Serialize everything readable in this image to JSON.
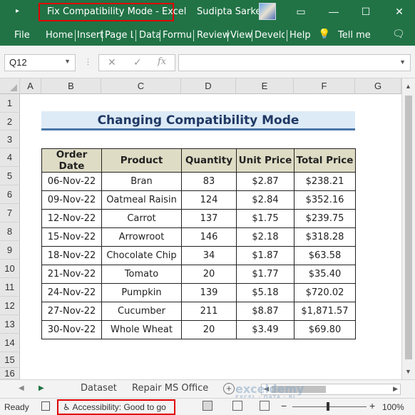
{
  "titlebar": {
    "title": "Fix Compatibility Mode  -  Excel",
    "user": "Sudipta Sarker",
    "quick_access": "▸",
    "restore_icon": "▭",
    "minimize_icon": "—",
    "maximize_icon": "☐",
    "close_icon": "✕"
  },
  "ribbon": {
    "tabs": [
      "File",
      "Home",
      "Insert",
      "Page La",
      "Data",
      "Formul",
      "Review",
      "View",
      "Develo",
      "Help"
    ],
    "tell_me": "Tell me",
    "tell_me_icon": "💡",
    "comment_icon": "🗨"
  },
  "formula_bar": {
    "name_box": "Q12",
    "cancel_icon": "✕",
    "enter_icon": "✓",
    "fx_icon": "fx",
    "formula": ""
  },
  "columns": [
    "A",
    "B",
    "C",
    "D",
    "E",
    "F",
    "G"
  ],
  "rows": [
    "1",
    "2",
    "3",
    "4",
    "5",
    "6",
    "7",
    "8",
    "9",
    "10",
    "11",
    "12",
    "13",
    "14",
    "15",
    "16"
  ],
  "sheet": {
    "banner_title": "Changing Compatibility Mode",
    "headers": [
      "Order Date",
      "Product",
      "Quantity",
      "Unit Price",
      "Total Price"
    ],
    "rows": [
      [
        "06-Nov-22",
        "Bran",
        "83",
        "$2.87",
        "$238.21"
      ],
      [
        "09-Nov-22",
        "Oatmeal Raisin",
        "124",
        "$2.84",
        "$352.16"
      ],
      [
        "12-Nov-22",
        "Carrot",
        "137",
        "$1.75",
        "$239.75"
      ],
      [
        "15-Nov-22",
        "Arrowroot",
        "146",
        "$2.18",
        "$318.28"
      ],
      [
        "18-Nov-22",
        "Chocolate Chip",
        "34",
        "$1.87",
        "$63.58"
      ],
      [
        "21-Nov-22",
        "Tomato",
        "20",
        "$1.77",
        "$35.40"
      ],
      [
        "24-Nov-22",
        "Pumpkin",
        "139",
        "$5.18",
        "$720.02"
      ],
      [
        "27-Nov-22",
        "Cucumber",
        "211",
        "$8.87",
        "$1,871.57"
      ],
      [
        "30-Nov-22",
        "Whole Wheat",
        "20",
        "$3.49",
        "$69.80"
      ]
    ]
  },
  "sheet_tabs": [
    "Dataset",
    "Repair MS Office"
  ],
  "statusbar": {
    "ready": "Ready",
    "accessibility": "Accessibility: Good to go",
    "zoom": "100%",
    "zoom_minus": "−",
    "zoom_plus": "+"
  },
  "watermark": {
    "name": "exceldemy",
    "tagline": "EXCEL · DATA · BI"
  },
  "colors": {
    "excel_green": "#217346",
    "highlight_red": "#e00000",
    "banner_bg": "#ddebf7",
    "banner_text": "#203864",
    "header_bg": "#dfdcc5"
  }
}
